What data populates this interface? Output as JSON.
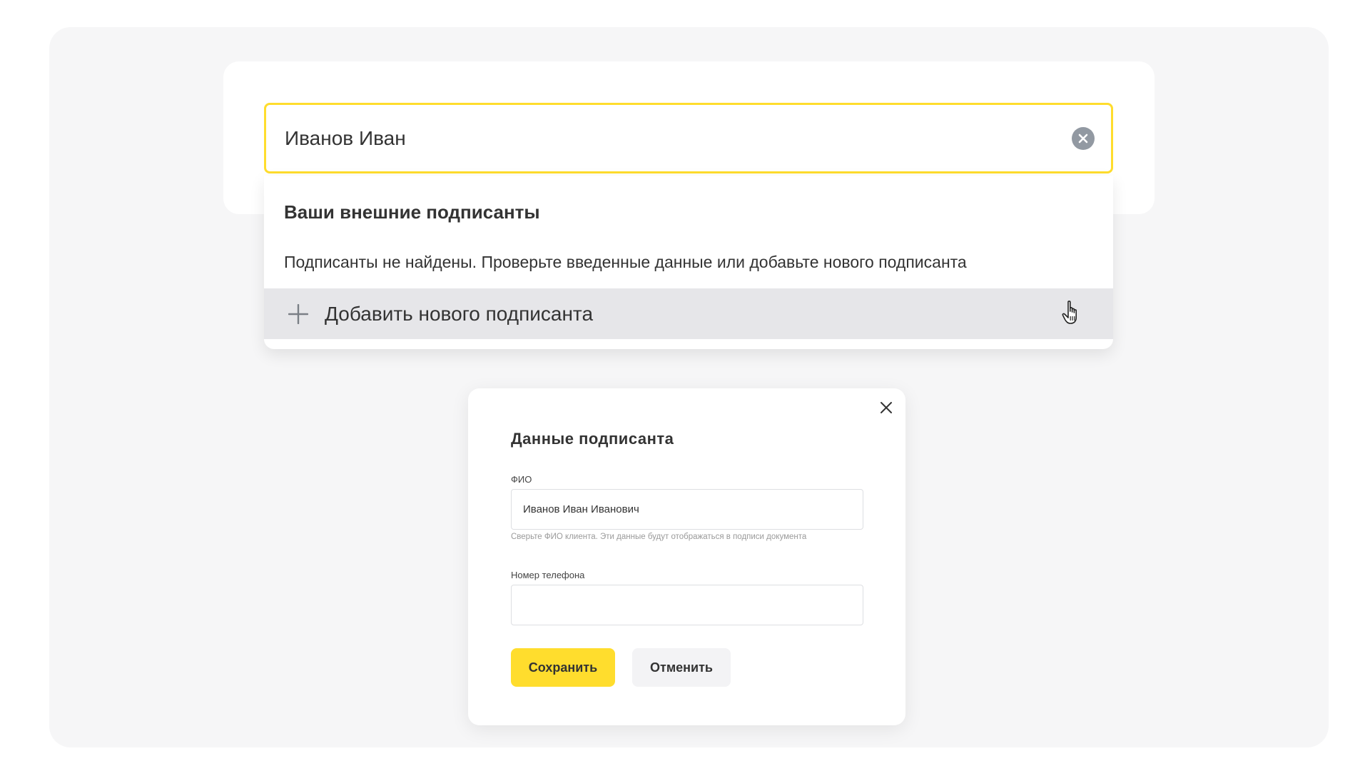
{
  "search": {
    "value": "Иванов Иван"
  },
  "dropdown": {
    "title": "Ваши внешние подписанты",
    "empty_message": "Подписанты не найдены. Проверьте введенные данные или добавьте нового подписанта",
    "add_label": "Добавить нового подписанта"
  },
  "modal": {
    "title": "Данные подписанта",
    "fio_label": "ФИО",
    "fio_value": "Иванов Иван Иванович",
    "fio_hint": "Сверьте ФИО клиента. Эти данные будут отображаться в подписи документа",
    "phone_label": "Номер телефона",
    "phone_value": "",
    "save_label": "Сохранить",
    "cancel_label": "Отменить"
  },
  "colors": {
    "accent": "#ffdd2d",
    "background": "#f6f6f7",
    "hover_row": "#e6e6e9",
    "clear_icon": "#9299a2"
  },
  "icons": {
    "clear": "close-circle-icon",
    "add": "plus-icon",
    "cursor": "hand-pointer-icon",
    "modal_close": "close-icon"
  }
}
